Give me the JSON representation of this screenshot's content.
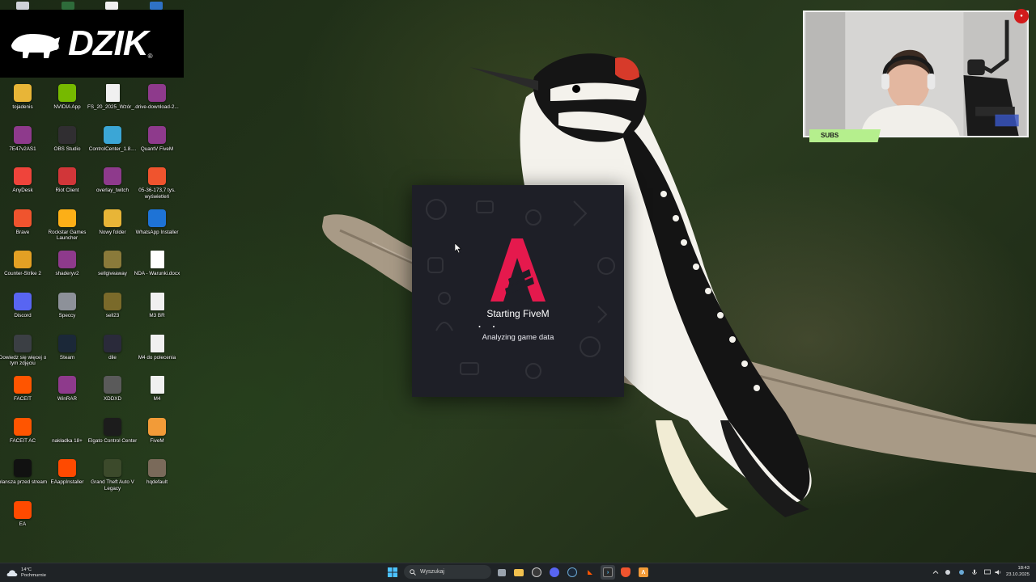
{
  "desktop": {
    "brand": "DZIK",
    "icons": [
      {
        "label": "tojadenis",
        "icon": "folder-icon",
        "color": "#e8b537"
      },
      {
        "label": "NVIDIA App",
        "icon": "nvidia-icon",
        "color": "#76b900"
      },
      {
        "label": "FS_20_2025_Wzór_...",
        "icon": "brave-doc-icon",
        "color": "#f0f0f0"
      },
      {
        "label": "drive-download-2...",
        "icon": "winrar-icon",
        "color": "#8e3a8c"
      },
      {
        "label": "7E47v2AS1",
        "icon": "winrar-icon",
        "color": "#8e3a8c"
      },
      {
        "label": "OBS Studio",
        "icon": "obs-icon",
        "color": "#302e31"
      },
      {
        "label": "ControlCenter_1.8....",
        "icon": "disc-installer-icon",
        "color": "#3ba6d6"
      },
      {
        "label": "QuantV FiveM",
        "icon": "winrar-icon",
        "color": "#8e3a8c"
      },
      {
        "label": "AnyDesk",
        "icon": "anydesk-icon",
        "color": "#ef443b"
      },
      {
        "label": "Riot Client",
        "icon": "riot-icon",
        "color": "#d13639"
      },
      {
        "label": "overlay_twitch",
        "icon": "winrar-icon",
        "color": "#8e3a8c"
      },
      {
        "label": "05-36-173,7 tys. wyświetleń",
        "icon": "brave-icon",
        "color": "#f0542e"
      },
      {
        "label": "Brave",
        "icon": "brave-icon",
        "color": "#f0542e"
      },
      {
        "label": "Rockstar Games Launcher",
        "icon": "rockstar-icon",
        "color": "#fcaf17"
      },
      {
        "label": "Nowy folder",
        "icon": "folder-icon",
        "color": "#e8b537"
      },
      {
        "label": "WhatsApp Installer",
        "icon": "download-icon",
        "color": "#1e73d6"
      },
      {
        "label": "Counter-Strike 2",
        "icon": "cs2-icon",
        "color": "#e3a024"
      },
      {
        "label": "shaderyv2",
        "icon": "winrar-icon",
        "color": "#8e3a8c"
      },
      {
        "label": "sellgiveaway",
        "icon": "image-icon",
        "color": "#8a7a3a"
      },
      {
        "label": "NDA - Warunki.docx",
        "icon": "document-icon",
        "color": "#ffffff"
      },
      {
        "label": "Discord",
        "icon": "discord-icon",
        "color": "#5865f2"
      },
      {
        "label": "Speccy",
        "icon": "speccy-icon",
        "color": "#8d9199"
      },
      {
        "label": "sell23",
        "icon": "image-icon",
        "color": "#7a6a2a"
      },
      {
        "label": "M3 BR",
        "icon": "brave-doc-icon",
        "color": "#f0f0f0"
      },
      {
        "label": "Dowiedz się więcej o tym zdjęciu",
        "icon": "camera-icon",
        "color": "#3b3f44"
      },
      {
        "label": "Steam",
        "icon": "steam-icon",
        "color": "#1b2838"
      },
      {
        "label": "dile",
        "icon": "dll-icon",
        "color": "#2a2a3a"
      },
      {
        "label": "M4 do polecenia",
        "icon": "brave-doc-icon",
        "color": "#f0f0f0"
      },
      {
        "label": "FACEIT",
        "icon": "faceit-icon",
        "color": "#ff5500"
      },
      {
        "label": "WinRAR",
        "icon": "winrar-icon",
        "color": "#8e3a8c"
      },
      {
        "label": "XDDXD",
        "icon": "image-icon",
        "color": "#5a5a5a"
      },
      {
        "label": "M4",
        "icon": "brave-doc-icon",
        "color": "#f0f0f0"
      },
      {
        "label": "FACEIT AC",
        "icon": "faceit-ac-icon",
        "color": "#ff5500"
      },
      {
        "label": "nakładka 18+",
        "icon": "blank-icon",
        "color": "transparent"
      },
      {
        "label": "Elgato Control Center",
        "icon": "elgato-icon",
        "color": "#1c1c1c"
      },
      {
        "label": "FiveM",
        "icon": "fivem-icon",
        "color": "#f29b38"
      },
      {
        "label": "plansza przed stream",
        "icon": "image-icon",
        "color": "#111111"
      },
      {
        "label": "EAappInstaller",
        "icon": "ea-icon",
        "color": "#ff4a00"
      },
      {
        "label": "Grand Theft Auto V Legacy",
        "icon": "gta-icon",
        "color": "#3c4a2b"
      },
      {
        "label": "hqdefault",
        "icon": "image-icon",
        "color": "#7a6a5a"
      },
      {
        "label": "EA",
        "icon": "ea-icon",
        "color": "#ff4a00"
      }
    ]
  },
  "splash": {
    "title": "Starting FiveM",
    "status": "Analyzing game data",
    "accent": "#e5194d",
    "background": "#1e1f27"
  },
  "webcam": {
    "badge": "SUBS",
    "badge_color": "#b5ef8d"
  },
  "taskbar": {
    "weather_temp": "14°C",
    "weather_desc": "Pochmurnie",
    "search_placeholder": "Wyszukaj",
    "apps": [
      "start-icon",
      "task-view-icon",
      "file-explorer-icon",
      "obs-icon",
      "discord-icon",
      "steam-icon",
      "faceit-icon",
      "terminal-icon",
      "brave-icon",
      "fivem-icon"
    ],
    "time": "18:43",
    "date": "23.10.2025"
  }
}
